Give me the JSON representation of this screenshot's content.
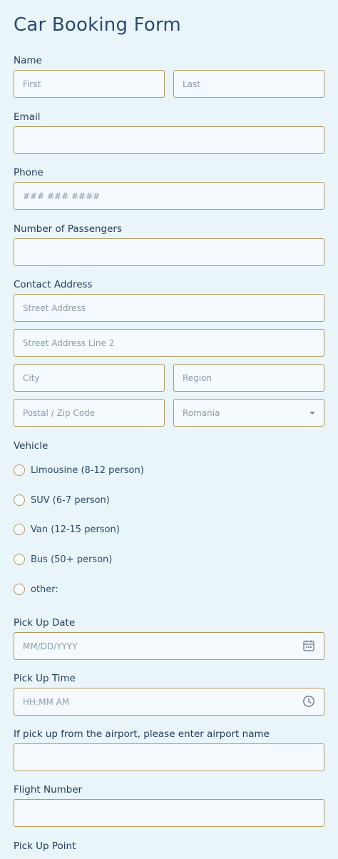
{
  "form": {
    "title": "Car Booking Form",
    "name": {
      "label": "Name",
      "first_placeholder": "First",
      "last_placeholder": "Last"
    },
    "email": {
      "label": "Email",
      "value": ""
    },
    "phone": {
      "label": "Phone",
      "placeholder": "### ### ####"
    },
    "passengers": {
      "label": "Number of Passengers",
      "value": ""
    },
    "address": {
      "label": "Contact Address",
      "street_placeholder": "Street Address",
      "street2_placeholder": "Street Address Line 2",
      "city_placeholder": "City",
      "region_placeholder": "Region",
      "zip_placeholder": "Postal / Zip Code",
      "country_value": "Romania"
    },
    "vehicle": {
      "label": "Vehicle",
      "options": [
        "Limousine (8-12 person)",
        "SUV (6-7 person)",
        "Van (12-15 person)",
        "Bus (50+ person)",
        "other:"
      ]
    },
    "pickup_date": {
      "label": "Pick Up Date",
      "placeholder": "MM/DD/YYYY"
    },
    "pickup_time": {
      "label": "Pick Up Time",
      "placeholder": "HH:MM AM"
    },
    "airport": {
      "label": "If pick up from the airport, please enter airport name",
      "value": ""
    },
    "flight": {
      "label": "Flight Number",
      "value": ""
    },
    "pickup_point": {
      "label": "Pick Up Point"
    }
  },
  "icons": {
    "calendar": "calendar-icon",
    "clock": "clock-icon",
    "dropdown": "chevron-down-icon"
  },
  "colors": {
    "background": "#eaf5fa",
    "field_bg": "#f4fafd",
    "field_border": "#b59a5c",
    "text": "#1f3a5a",
    "placeholder": "#8c9cad"
  }
}
